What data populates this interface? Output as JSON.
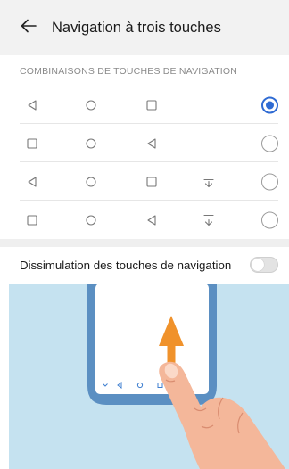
{
  "header": {
    "title": "Navigation à trois touches",
    "back_icon": "arrow-left-icon"
  },
  "combinations": {
    "section_title": "COMBINAISONS DE TOUCHES DE NAVIGATION",
    "options": [
      {
        "keys": [
          "back-triangle-icon",
          "home-circle-icon",
          "recent-square-icon"
        ],
        "selected": true
      },
      {
        "keys": [
          "recent-square-icon",
          "home-circle-icon",
          "back-triangle-icon"
        ],
        "selected": false
      },
      {
        "keys": [
          "back-triangle-icon",
          "home-circle-icon",
          "recent-square-icon",
          "notification-down-icon"
        ],
        "selected": false
      },
      {
        "keys": [
          "recent-square-icon",
          "home-circle-icon",
          "back-triangle-icon",
          "notification-down-icon"
        ],
        "selected": false
      }
    ]
  },
  "hide_nav": {
    "label": "Dissimulation des touches de navigation",
    "enabled": false
  },
  "colors": {
    "accent": "#2f6bd3",
    "illustration_bg": "#c5e2f0",
    "phone_frame": "#5b8fc2",
    "arrow": "#f0922b",
    "finger": "#f4b79a"
  }
}
